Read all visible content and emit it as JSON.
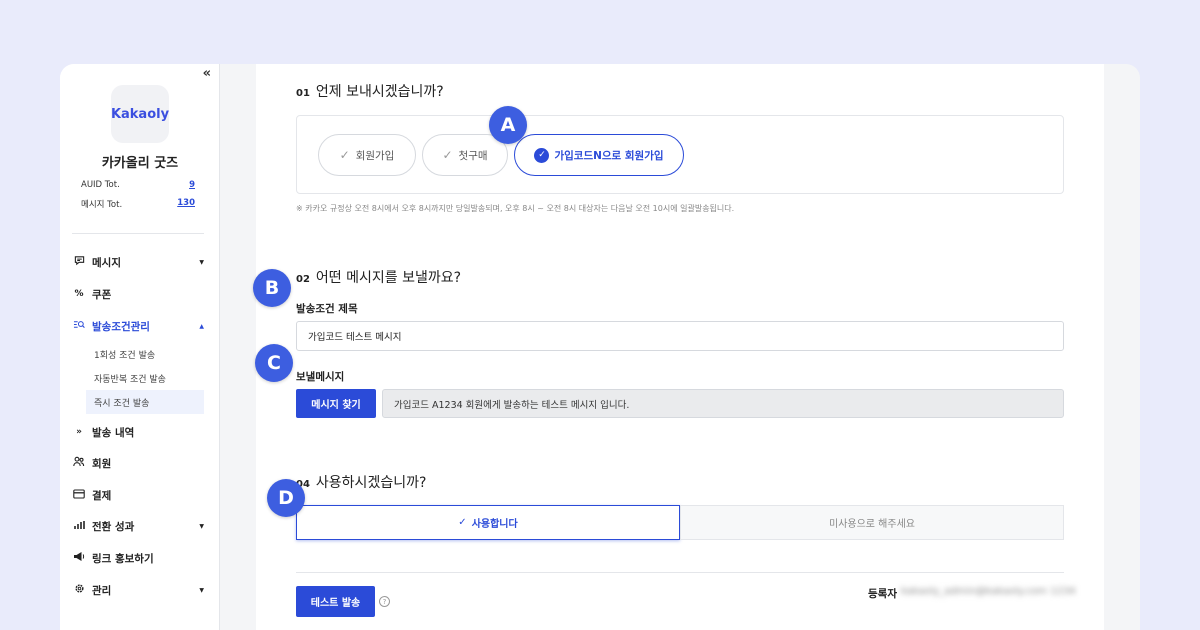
{
  "sidebar": {
    "collapse_icon": "«",
    "logo_text": "Kakaoly",
    "shop_name": "카카올리 굿즈",
    "stats": [
      {
        "label": "AUID Tot.",
        "value": "9"
      },
      {
        "label": "메시지 Tot.",
        "value": "130"
      }
    ],
    "menu": [
      {
        "label": "메시지",
        "icon": "chat-icon"
      },
      {
        "label": "쿠폰",
        "icon": "percent-icon"
      },
      {
        "label": "발송조건관리",
        "icon": "search-list-icon"
      },
      {
        "label": "발송 내역",
        "icon": "send-arrows-icon"
      },
      {
        "label": "회원",
        "icon": "users-icon"
      },
      {
        "label": "결제",
        "icon": "card-icon"
      },
      {
        "label": "전환 성과",
        "icon": "bar-chart-icon"
      },
      {
        "label": "링크 홍보하기",
        "icon": "megaphone-icon"
      },
      {
        "label": "관리",
        "icon": "gear-icon"
      }
    ],
    "submenu": [
      "1회성 조건 발송",
      "자동반복 조건 발송",
      "즉시 조건 발송"
    ]
  },
  "main": {
    "section1": {
      "num": "01",
      "title": "언제 보내시겠습니까?",
      "options": [
        "회원가입",
        "첫구매",
        "가입코드N으로 회원가입"
      ],
      "note": "※ 카카오 규정상 오전 8시에서 오후 8시까지만 당일발송되며, 오후 8시 ~ 오전 8시 대상자는 다음날 오전 10시에 일괄발송됩니다."
    },
    "section2": {
      "num": "02",
      "title": "어떤 메시지를 보낼까요?",
      "title_field_label": "발송조건 제목",
      "title_field_value": "가입코드 테스트 메시지",
      "message_label": "보낼메시지",
      "find_button": "메시지 찾기",
      "message_value": "가입코드 A1234 회원에게 발송하는 테스트 메시지 입니다."
    },
    "section4": {
      "num": "04",
      "title": "사용하시겠습니까?",
      "use_label": "사용합니다",
      "unuse_label": "미사용으로 해주세요"
    },
    "test_button": "테스트 발송",
    "help_icon": "?",
    "registrant_label": "등록자",
    "registrant_value": "kakaoly_admin@kakaoly.com 1234"
  },
  "badges": [
    "A",
    "B",
    "C",
    "D"
  ],
  "colors": {
    "accent": "#2b4bd8",
    "badge": "#3d5ee0",
    "background": "#e9ebfb"
  }
}
